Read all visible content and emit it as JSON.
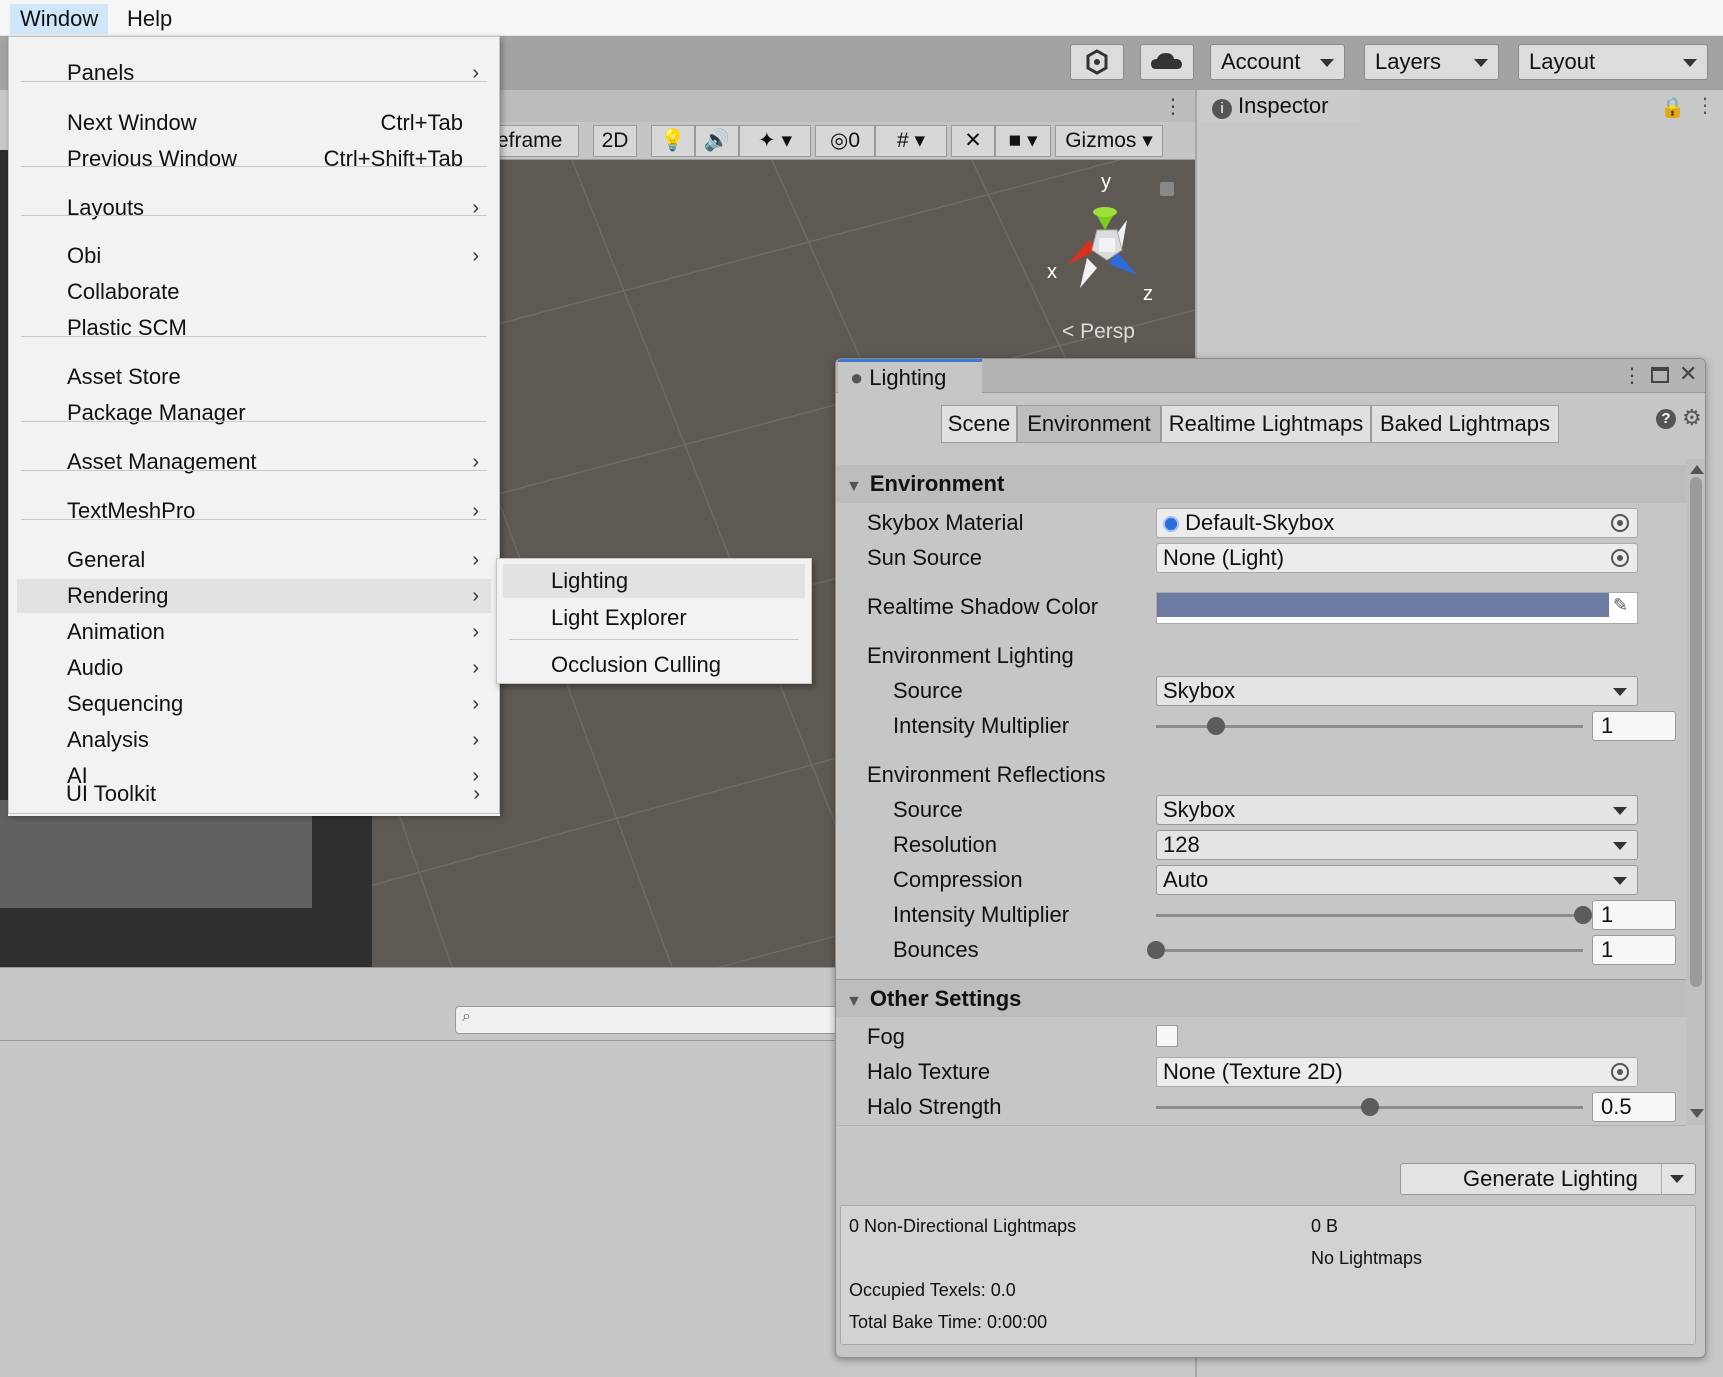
{
  "menubar": {
    "window": "Window",
    "help": "Help"
  },
  "toolbar": {
    "account": "Account",
    "layers": "Layers",
    "layout": "Layout"
  },
  "scene": {
    "draw_mode_partial": "eframe",
    "mode_2d": "2D",
    "hidden_count": "0",
    "gizmos": "Gizmos",
    "axis_x": "x",
    "axis_y": "y",
    "axis_z": "z",
    "persp": "Persp"
  },
  "inspector": {
    "tab": "Inspector"
  },
  "window_menu": {
    "items": [
      {
        "label": "Panels"
      },
      {
        "label": "Next Window",
        "shortcut": "Ctrl+Tab"
      },
      {
        "label": "Previous Window",
        "shortcut": "Ctrl+Shift+Tab"
      },
      {
        "label": "Layouts"
      },
      {
        "label": "Obi"
      },
      {
        "label": "Collaborate"
      },
      {
        "label": "Plastic SCM"
      },
      {
        "label": "Asset Store"
      },
      {
        "label": "Package Manager"
      },
      {
        "label": "Asset Management"
      },
      {
        "label": "TextMeshPro"
      },
      {
        "label": "General"
      },
      {
        "label": "Rendering"
      },
      {
        "label": "Animation"
      },
      {
        "label": "Audio"
      },
      {
        "label": "Sequencing"
      },
      {
        "label": "Analysis"
      },
      {
        "label": "AI"
      },
      {
        "label": "UI Toolkit"
      }
    ],
    "arrow": "›"
  },
  "rendering_submenu": {
    "items": [
      {
        "label": "Lighting"
      },
      {
        "label": "Light Explorer"
      },
      {
        "label": "Occlusion Culling"
      }
    ]
  },
  "lighting": {
    "title": "Lighting",
    "tabs": [
      "Scene",
      "Environment",
      "Realtime Lightmaps",
      "Baked Lightmaps"
    ],
    "selected_tab": "Environment",
    "environment_header": "Environment",
    "skybox_material_label": "Skybox Material",
    "skybox_material_value": "Default-Skybox",
    "sun_source_label": "Sun Source",
    "sun_source_value": "None (Light)",
    "shadow_color_label": "Realtime Shadow Color",
    "shadow_color": "#6c7ba1",
    "env_lighting_label": "Environment Lighting",
    "env_source_label": "Source",
    "env_source_value": "Skybox",
    "env_intensity_label": "Intensity Multiplier",
    "env_intensity_value": "1",
    "env_intensity_fraction": 0.14,
    "env_reflections_label": "Environment Reflections",
    "refl_source_label": "Source",
    "refl_source_value": "Skybox",
    "resolution_label": "Resolution",
    "resolution_value": "128",
    "compression_label": "Compression",
    "compression_value": "Auto",
    "refl_intensity_label": "Intensity Multiplier",
    "refl_intensity_value": "1",
    "refl_intensity_fraction": 1.0,
    "bounces_label": "Bounces",
    "bounces_value": "1",
    "bounces_fraction": 0.0,
    "other_header": "Other Settings",
    "fog_label": "Fog",
    "fog_checked": false,
    "halo_texture_label": "Halo Texture",
    "halo_texture_value": "None (Texture 2D)",
    "halo_strength_label": "Halo Strength",
    "halo_strength_value": "0.5",
    "halo_strength_fraction": 0.5,
    "generate_button": "Generate Lighting",
    "stats": {
      "lightmaps": "0 Non-Directional Lightmaps",
      "size": "0 B",
      "no_lightmaps": "No Lightmaps",
      "texels": "Occupied Texels: 0.0",
      "bake_time": "Total Bake Time: 0:00:00"
    }
  },
  "colors": {
    "scene_bg": "#5f5953",
    "menu_highlight": "#cfe6fb",
    "axis_x": "#d8301f",
    "axis_y": "#7ccc1f",
    "axis_z": "#2e6bd8"
  }
}
